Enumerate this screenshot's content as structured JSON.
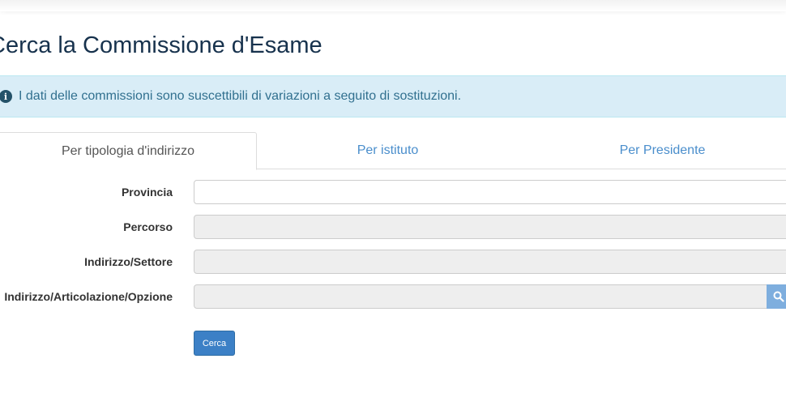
{
  "page": {
    "title": "Cerca la Commissione d'Esame"
  },
  "alert": {
    "icon": "info-circle-icon",
    "text": "I dati delle commissioni sono suscettibili di variazioni a seguito di sostituzioni."
  },
  "tabs": [
    {
      "label": "Per tipologia d'indirizzo",
      "active": true
    },
    {
      "label": "Per istituto",
      "active": false
    },
    {
      "label": "Per Presidente",
      "active": false
    }
  ],
  "form": {
    "fields": [
      {
        "label": "Provincia",
        "value": "",
        "disabled": false
      },
      {
        "label": "Percorso",
        "value": "",
        "disabled": true
      },
      {
        "label": "Indirizzo/Settore",
        "value": "",
        "disabled": true
      },
      {
        "label": "Indirizzo/Articolazione/Opzione",
        "value": "",
        "disabled": true,
        "addon_icon": "search-icon"
      }
    ],
    "submit_label": "Cerca"
  },
  "colors": {
    "title": "#17324d",
    "alert_bg": "#d9edf7",
    "alert_text": "#31708f",
    "link": "#4a8ecc",
    "primary_button": "#3c80c6"
  }
}
